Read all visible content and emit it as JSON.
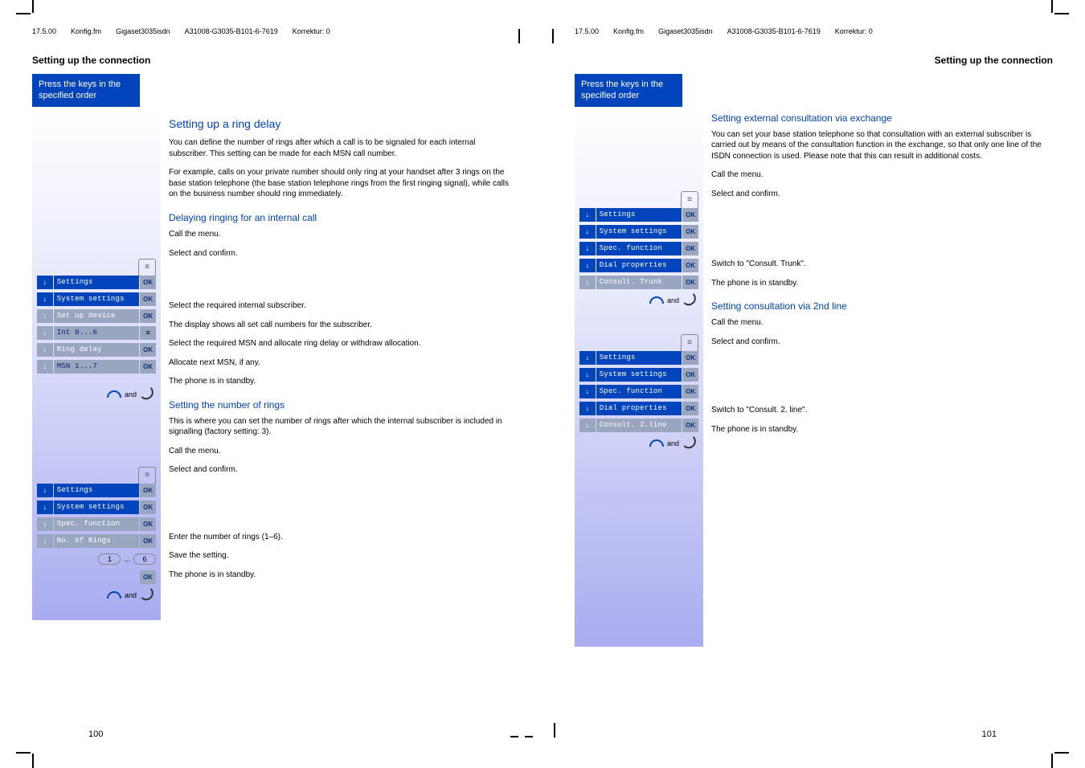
{
  "meta": {
    "date": "17.5.00",
    "file": "Konfig.fm",
    "product": "Gigaset3035isdn",
    "doc_id": "A31008-G3035-B101-6-7619",
    "korrektur": "Korrektur: 0"
  },
  "common": {
    "section_title": "Setting up the connection",
    "press_keys_line1": "Press the keys in the",
    "press_keys_line2": "specified order",
    "ok": "OK",
    "arrow": "↓",
    "and": "and",
    "standby": "The phone is in standby.",
    "call_menu": "Call the menu.",
    "select_confirm": "Select and confirm.",
    "save_setting": "Save the setting."
  },
  "left": {
    "h2": "Setting up a ring delay",
    "p1": "You can define the number of rings after which a call is to be signaled for each internal subscriber. This setting can be made for each MSN call number.",
    "p2": "For example, calls on your private number should only ring at your handset after 3 rings on the base station telephone (the base station telephone rings from the first ringing signal), while calls on the business number should ring immediately.",
    "h3a": "Delaying ringing for an internal call",
    "menu_a": {
      "settings": "Settings",
      "system": "System settings",
      "setup": "Set up device",
      "int": "Int 0...6",
      "ring_delay": "Ring delay",
      "msn": "MSN 1...7"
    },
    "txt_select_sub": "Select the required internal subscriber.",
    "txt_display_msn": "The display shows all set call numbers for the subscriber.",
    "txt_select_msn": "Select the required MSN and allocate ring delay or withdraw allocation.",
    "txt_next_msn": "Allocate next MSN, if any.",
    "h3b": "Setting the number of rings",
    "p3": "This is where you can set the number of rings after which the internal subscriber is included in signalling (factory setting: 3).",
    "menu_b": {
      "settings": "Settings",
      "system": "System settings",
      "spec": "Spec. function",
      "no_rings": "No. of Rings"
    },
    "key_1": "1",
    "key_6": "6",
    "key_ellipsis": "...",
    "txt_enter_rings": "Enter the number of rings (1–6).",
    "page_num": "100"
  },
  "right": {
    "h3a": "Setting external consultation via exchange",
    "p1": "You can set your base station telephone so that consultation with an external subscriber is carried out by means of the consultation function in the exchange, so that only one line of the ISDN connection is used. Please note that this can result in additional costs.",
    "menu_a": {
      "settings": "Settings",
      "system": "System settings",
      "spec": "Spec. function",
      "dial": "Dial properties",
      "consult_trunk": "Consult. Trunk"
    },
    "txt_switch_trunk": "Switch to \"Consult. Trunk\".",
    "h3b": "Setting consultation via 2nd line",
    "menu_b": {
      "settings": "Settings",
      "system": "System settings",
      "spec": "Spec. function",
      "dial": "Dial properties",
      "consult_2line": "Consult. 2.line"
    },
    "txt_switch_2line": "Switch to \"Consult. 2. line\".",
    "page_num": "101"
  }
}
